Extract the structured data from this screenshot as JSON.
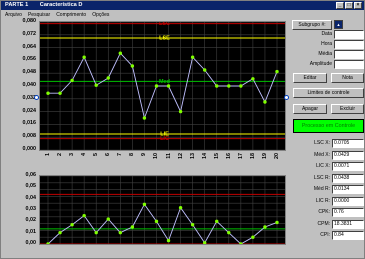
{
  "window": {
    "title_part": "PARTE 1",
    "title_name": "Característica D",
    "controls": [
      "_",
      "□",
      "×"
    ]
  },
  "menu": [
    "Arquivo",
    "Pesquisar",
    "Comprimento",
    "Opções"
  ],
  "top_chart": {
    "y_ticks": [
      "0,080",
      "0,072",
      "0,064",
      "0,056",
      "0,048",
      "0,040",
      "0,032",
      "0,024",
      "0,016",
      "0,008",
      "0,000"
    ],
    "x_ticks": [
      "1",
      "2",
      "3",
      "4",
      "5",
      "6",
      "7",
      "8",
      "9",
      "10",
      "11",
      "12",
      "13",
      "14",
      "15",
      "16",
      "17",
      "18",
      "19",
      "20"
    ],
    "lsc_label": "LSC",
    "lse_label": "LSE",
    "med_label": "Med",
    "lie_label": "LIE",
    "lic_label": "LIC",
    "colors": {
      "lsc": "#c00000",
      "lse": "#ffff00",
      "med": "#00c000",
      "lie": "#ffff00",
      "lic": "#c00000",
      "series": "#c0c0ff",
      "point": "#80ff00"
    }
  },
  "bottom_chart": {
    "y_ticks": [
      "0,06",
      "0,05",
      "0,04",
      "0,03",
      "0,02",
      "0,01",
      "0,00"
    ]
  },
  "chart_data": [
    {
      "type": "line",
      "x": [
        1,
        2,
        3,
        4,
        5,
        6,
        7,
        8,
        9,
        10,
        11,
        12,
        13,
        14,
        15,
        16,
        17,
        18,
        19,
        20
      ],
      "series": [
        {
          "values": [
            0.0355,
            0.0355,
            0.0435,
            0.058,
            0.0405,
            0.045,
            0.0605,
            0.0525,
            0.02,
            0.04,
            0.04,
            0.024,
            0.058,
            0.05,
            0.04,
            0.04,
            0.04,
            0.0445,
            0.03,
            0.049
          ]
        }
      ],
      "limits": {
        "lsc": 0.079,
        "lse": 0.07,
        "med": 0.0429,
        "lie": 0.01,
        "lic": 0.0071
      },
      "ylim": [
        0,
        0.08
      ]
    },
    {
      "type": "line",
      "x": [
        1,
        2,
        3,
        4,
        5,
        6,
        7,
        8,
        9,
        10,
        11,
        12,
        13,
        14,
        15,
        16,
        17,
        18,
        19,
        20
      ],
      "series": [
        {
          "values": [
            0.0,
            0.01,
            0.017,
            0.025,
            0.01,
            0.022,
            0.01,
            0.015,
            0.035,
            0.02,
            0.003,
            0.032,
            0.017,
            0.001,
            0.02,
            0.01,
            0.0,
            0.006,
            0.015,
            0.019
          ]
        }
      ],
      "limits": {
        "lsc": 0.0438,
        "med": 0.0134,
        "lic": 0.0
      },
      "ylim": [
        0,
        0.06
      ]
    }
  ],
  "panel": {
    "subgroup_label": "Subgrupo #:",
    "subgroup_value": "",
    "data_label": "Data",
    "hora_label": "Hora",
    "media_label": "Média",
    "amplitude_label": "Amplitude",
    "data_value": "",
    "hora_value": "",
    "media_value": "",
    "amplitude_value": "",
    "editar": "Editar",
    "nota": "Nota",
    "limites": "Limites de controle",
    "apagar": "Apagar",
    "excluir": "Excluir",
    "processo": "Processo em Controle",
    "stats": [
      {
        "label": "LSC X:",
        "value": "0.0705"
      },
      {
        "label": "Méd X:",
        "value": "0.0429"
      },
      {
        "label": "LIC X:",
        "value": "0.0071"
      },
      {
        "label": "LSC R:",
        "value": "0.0438"
      },
      {
        "label": "Méd R:",
        "value": "0.0134"
      },
      {
        "label": "LIC R:",
        "value": "0.0000"
      },
      {
        "label": "CPK:",
        "value": "0.76"
      },
      {
        "label": "CPM:",
        "value": "18.3831"
      },
      {
        "label": "CPI:",
        "value": "0.84"
      }
    ]
  }
}
